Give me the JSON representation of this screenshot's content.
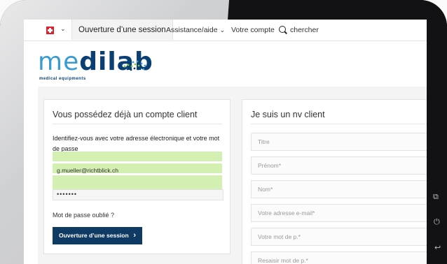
{
  "nav": {
    "active": "Ouverture d’une session",
    "assist": "Assistance/aide",
    "account": "Votre compte",
    "search": "chercher"
  },
  "logo": {
    "part1": "me",
    "part2": "dilab",
    "sub": "medical equipments"
  },
  "left": {
    "title": "Vous possédez déjà un compte client",
    "instr": "Identifiez-vous avec votre adresse électronique et votre mot de passe",
    "email": "g.mueller@richtblick.ch",
    "pw": "•••••••",
    "forgot": "Mot de passe oublié ?",
    "button": "Ouverture d’une session"
  },
  "right": {
    "title": "Je suis un nv client",
    "fields": [
      "Titre",
      "Prénom*",
      "Nom*",
      "Votre adresse e-mail*",
      "Votre mot de p.*",
      "Resaisir mot de p.*"
    ]
  },
  "colors": {
    "brand_dark": "#0f3a63",
    "brand_blue": "#3a9bd2",
    "brand_green": "#7cc242",
    "highlight": "#d3efb1",
    "flag": "#e01f2f"
  },
  "icons": [
    "swiss-flag-icon",
    "chevron-down-icon",
    "search-icon",
    "arrow-right-icon",
    "copy-icon",
    "power-icon",
    "back-icon"
  ]
}
